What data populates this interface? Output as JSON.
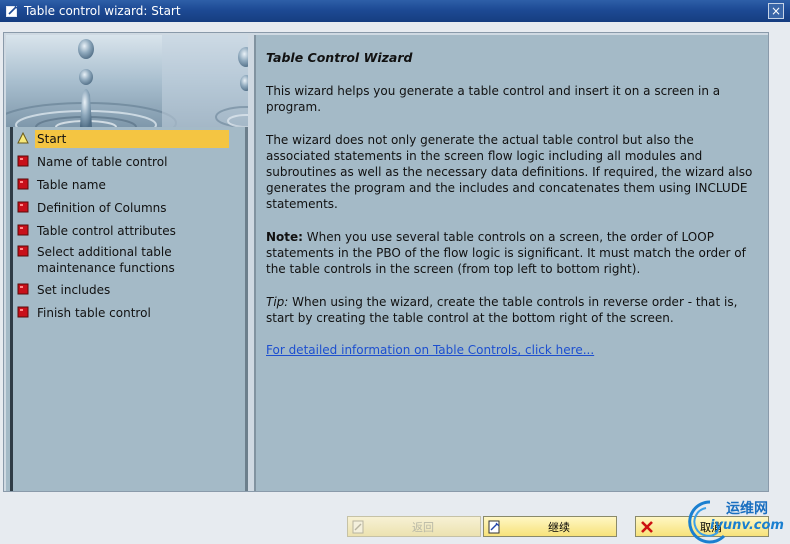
{
  "window": {
    "title": "Table control wizard: Start",
    "close_symbol": "×"
  },
  "steps": [
    {
      "label": "Start",
      "state": "current",
      "icon": "warning-triangle-icon"
    },
    {
      "label": "Name of table control",
      "state": "pending",
      "icon": "red-square-icon"
    },
    {
      "label": "Table name",
      "state": "pending",
      "icon": "red-square-icon"
    },
    {
      "label": "Definition of Columns",
      "state": "pending",
      "icon": "red-square-icon"
    },
    {
      "label": "Table control attributes",
      "state": "pending",
      "icon": "red-square-icon"
    },
    {
      "label": "Select additional table maintenance functions",
      "state": "pending",
      "icon": "red-square-icon"
    },
    {
      "label": "Set includes",
      "state": "pending",
      "icon": "red-square-icon"
    },
    {
      "label": "Finish table control",
      "state": "pending",
      "icon": "red-square-icon"
    }
  ],
  "content": {
    "heading": "Table Control Wizard",
    "p1": "This wizard helps you generate a table control and insert it on a screen in a program.",
    "p2": "The wizard does not only generate the actual table control but also the associated statements in the screen flow logic including all modules and subroutines as well as the necessary data definitions. If required, the wizard also generates the program and the includes and concatenates them using INCLUDE statements.",
    "note_label": "Note:",
    "note_text": " When you use several table controls on a screen, the order of LOOP statements in the PBO of the flow logic is significant. It must match the order of the table controls in the screen (from top left to bottom right).",
    "tip_label": "Tip:",
    "tip_text": " When using the wizard, create the table controls in reverse order - that is, start by creating the table control at the bottom right of the screen.",
    "link": "For detailed information on Table Controls, click here..."
  },
  "buttons": {
    "back": "返回",
    "continue": "继续",
    "cancel": "取消"
  },
  "watermark": {
    "text1": "运维网",
    "text2": "iyunv.com"
  },
  "colors": {
    "titlebar": "#1d4a94",
    "pane": "#a4bac7",
    "active_step": "#f4c542",
    "link": "#1d4fcf",
    "button": "#f7e27a"
  }
}
